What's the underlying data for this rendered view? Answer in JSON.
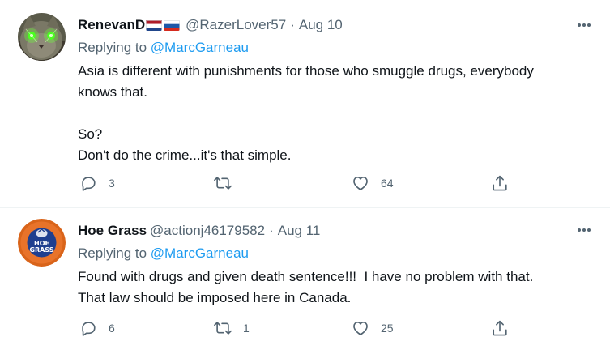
{
  "tweets": [
    {
      "display_name": "RenevanD",
      "flags": [
        "netherlands-flag",
        "russia-flag"
      ],
      "handle": "@RazerLover57",
      "separator": "·",
      "date": "Aug 10",
      "replying_prefix": "Replying to",
      "replying_mention": "@MarcGarneau",
      "text_lines": [
        "Asia is different with punishments for those who smuggle drugs, everybody",
        "knows that.",
        "",
        "So?",
        "Don't do the crime...it's that simple."
      ],
      "counts": {
        "reply": "3",
        "retweet": "",
        "like": "64"
      },
      "avatar_icon": "green-eyed-cat-avatar"
    },
    {
      "display_name": "Hoe Grass",
      "handle": "@actionj46179582",
      "separator": "·",
      "date": "Aug 11",
      "replying_prefix": "Replying to",
      "replying_mention": "@MarcGarneau",
      "text_lines": [
        "Found with drugs and given death sentence!!!  I have no problem with that.",
        "That law should be imposed here in Canada."
      ],
      "counts": {
        "reply": "6",
        "retweet": "1",
        "like": "25"
      },
      "avatar_icon": "hoe-grass-logo-avatar",
      "avatar_logo_text": "HOE GRASS"
    }
  ],
  "colors": {
    "text_primary": "#0f1419",
    "text_secondary": "#536471",
    "link": "#1d9bf0",
    "divider": "#eff3f4"
  }
}
